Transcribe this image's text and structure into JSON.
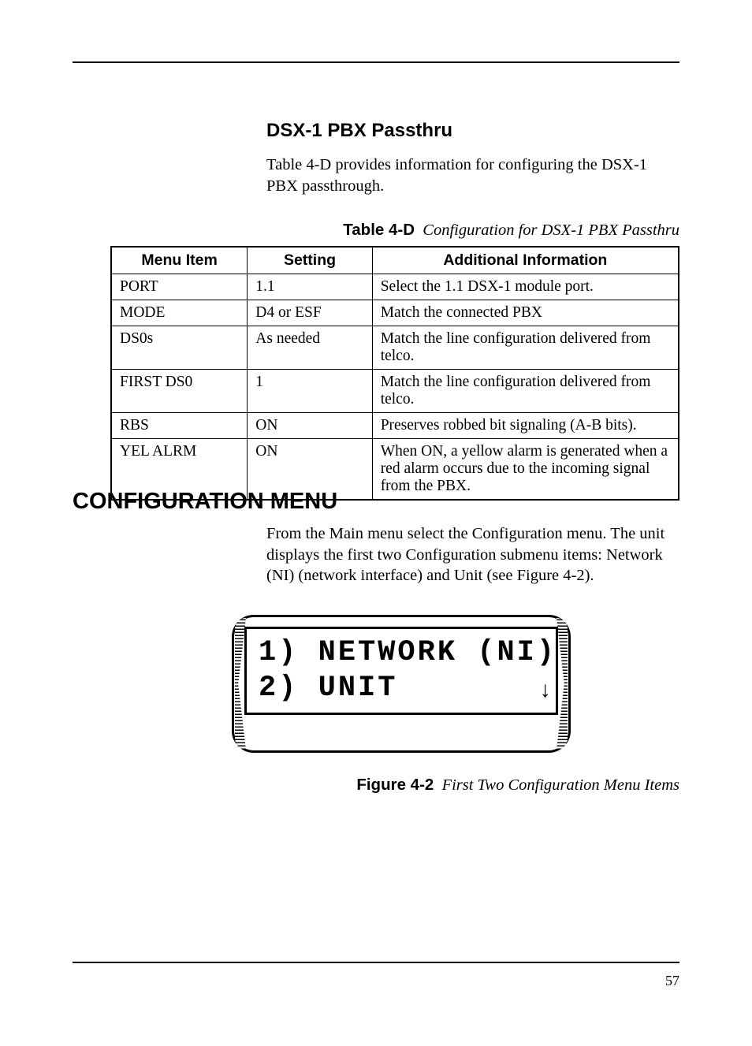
{
  "header": {
    "rule_visible": true
  },
  "section1": {
    "title": "DSX-1 PBX Passthru",
    "para": "Table 4-D provides information for configuring the DSX-1 PBX passthrough."
  },
  "table": {
    "caption_lead": "Table 4-D",
    "caption_desc": "Configuration for DSX-1 PBX Passthru",
    "headers": {
      "col1": "Menu Item",
      "col2": "Setting",
      "col3": "Additional Information"
    },
    "rows": [
      {
        "item": "PORT",
        "setting": "1.1",
        "info": "Select the 1.1 DSX-1 module port."
      },
      {
        "item": "MODE",
        "setting": "D4 or ESF",
        "info": "Match the connected PBX"
      },
      {
        "item": "DS0s",
        "setting": "As needed",
        "info": "Match the line configuration delivered from telco."
      },
      {
        "item": "FIRST DS0",
        "setting": "1",
        "info": "Match the line configuration delivered from telco."
      },
      {
        "item": "RBS",
        "setting": "ON",
        "info": "Preserves robbed bit signaling (A-B bits)."
      },
      {
        "item": "YEL ALRM",
        "setting": "ON",
        "info": "When ON, a yellow alarm is generated when a red alarm occurs due to the incoming signal from the PBX."
      }
    ]
  },
  "section2": {
    "title": "CONFIGURATION MENU",
    "para": "From the Main menu select the Configuration menu.  The unit displays the first two Configuration submenu items:  Network (NI) (network interface) and Unit (see Figure 4-2)."
  },
  "lcd": {
    "line1": "1) NETWORK (NI)",
    "line2": "2) UNIT",
    "down_indicator": "↓"
  },
  "figure": {
    "caption_lead": "Figure 4-2",
    "caption_desc": "First Two Configuration Menu Items"
  },
  "page": {
    "number": "57"
  },
  "chart_data": {
    "type": "table",
    "title": "Configuration for DSX-1 PBX Passthru",
    "columns": [
      "Menu Item",
      "Setting",
      "Additional Information"
    ],
    "rows": [
      [
        "PORT",
        "1.1",
        "Select the 1.1 DSX-1 module port."
      ],
      [
        "MODE",
        "D4 or ESF",
        "Match the connected PBX"
      ],
      [
        "DS0s",
        "As needed",
        "Match the line configuration delivered from telco."
      ],
      [
        "FIRST DS0",
        "1",
        "Match the line configuration delivered from telco."
      ],
      [
        "RBS",
        "ON",
        "Preserves robbed bit signaling (A-B bits)."
      ],
      [
        "YEL ALRM",
        "ON",
        "When ON, a yellow alarm is generated when a red alarm occurs due to the incoming signal from the PBX."
      ]
    ]
  }
}
